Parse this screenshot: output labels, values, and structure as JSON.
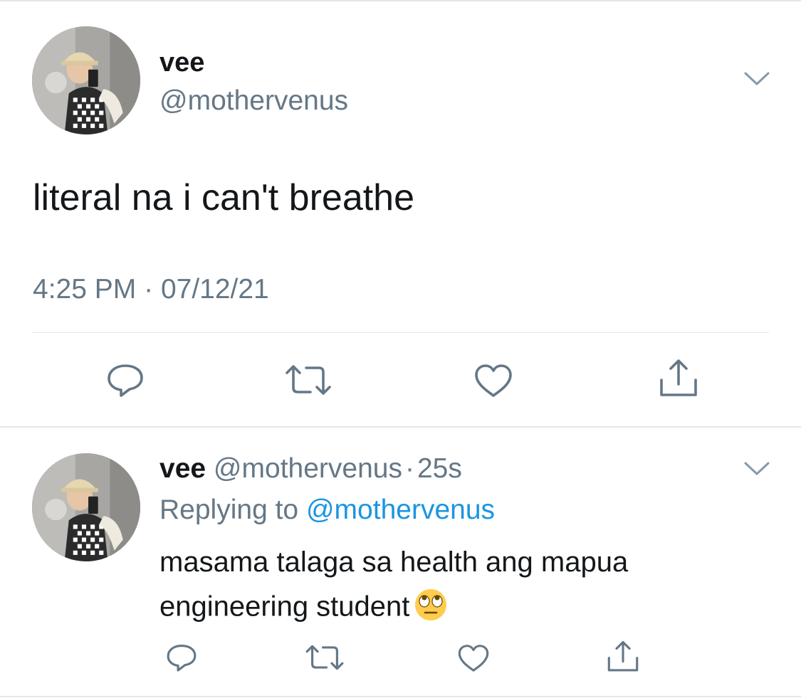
{
  "main_tweet": {
    "display_name": "vee",
    "handle": "@mothervenus",
    "text": "literal na i can't breathe",
    "time": "4:25 PM",
    "separator": "·",
    "date": "07/12/21"
  },
  "reply_tweet": {
    "display_name": "vee",
    "handle": "@mothervenus",
    "separator": "·",
    "age": "25s",
    "replying_prefix": "Replying to",
    "replying_handle": "@mothervenus",
    "text_line1": "masama talaga sa health ang mapua",
    "text_line2": "engineering student",
    "emoji": "face-with-rolling-eyes"
  },
  "actions": [
    "reply-icon",
    "retweet-icon",
    "like-icon",
    "share-icon"
  ],
  "colors": {
    "text": "#14171a",
    "secondary": "#657786",
    "link": "#1b95e0",
    "divider": "#e1e8ed"
  }
}
